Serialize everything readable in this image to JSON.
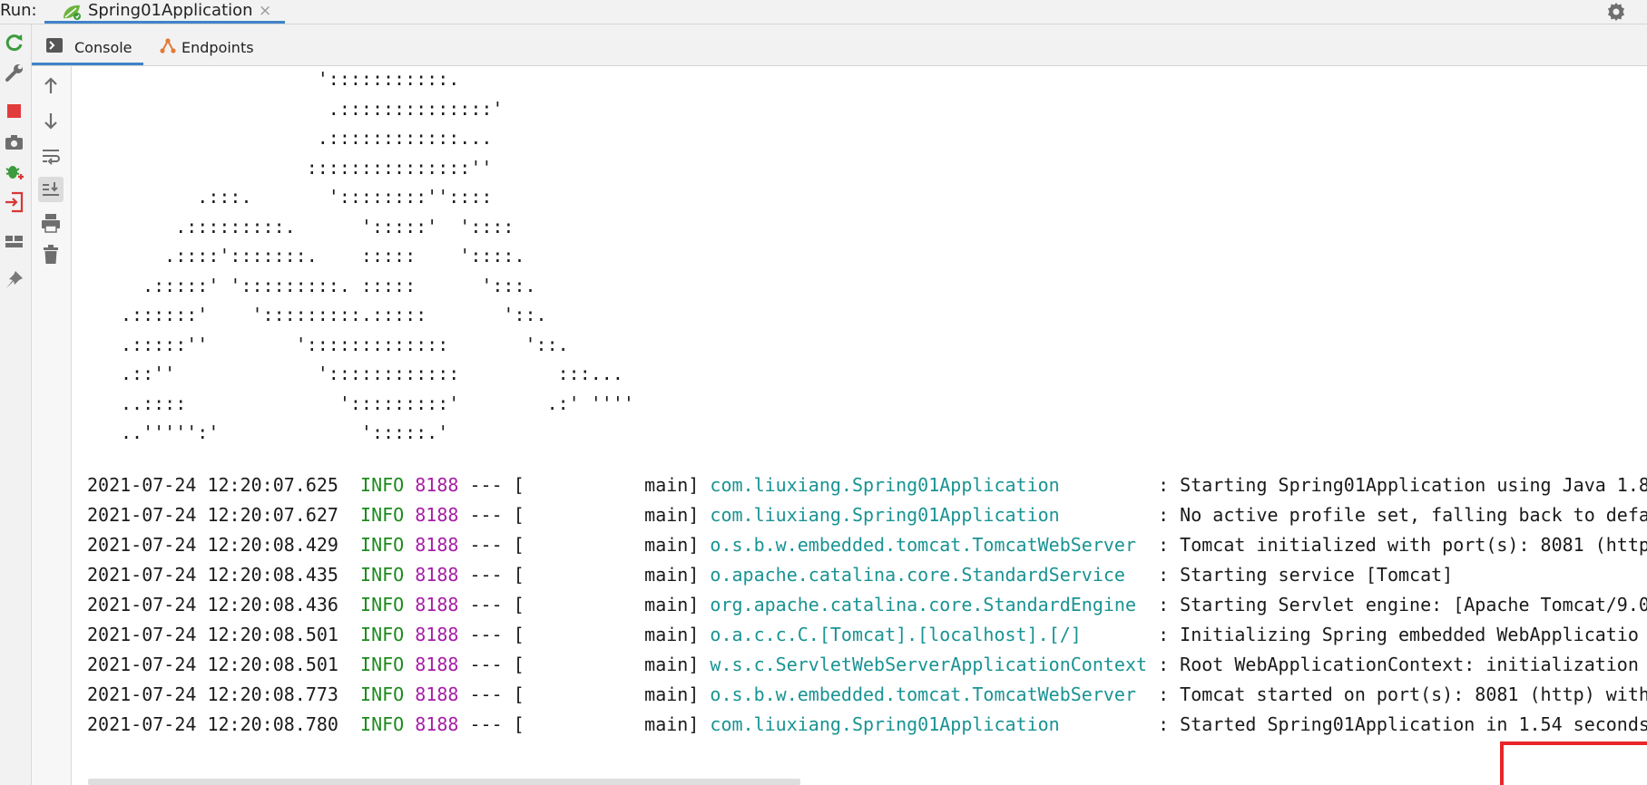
{
  "runbar": {
    "label": "Run:",
    "tab_title": "Spring01Application",
    "close": "×"
  },
  "subtabs": [
    {
      "label": "Console",
      "icon": "console-icon",
      "active": true
    },
    {
      "label": "Endpoints",
      "icon": "endpoints-icon",
      "active": false
    }
  ],
  "left_toolbar": [
    "rerun-icon",
    "wrench-icon",
    "stop-icon",
    "camera-icon",
    "debug-icon",
    "exit-icon",
    "layout-icon",
    "pin-icon"
  ],
  "console_toolbar": [
    "arrow-up-icon",
    "arrow-down-icon",
    "soft-wrap-icon",
    "scroll-to-end-icon",
    "print-icon",
    "trash-icon"
  ],
  "ascii_art": [
    "                  ':::::::::::.",
    "                   .::::::::::::::'",
    "                  .::::::::::::...",
    "                 :::::::::::::::''",
    "       .:::.       '::::::::''::::",
    "     .:::::::::.      ':::::'  '::::",
    "    .::::':::::::.    :::::    '::::.",
    "  .:::::' ':::::::::. :::::      ':::.",
    ".::::::'    ':::::::::.:::::       '::.",
    ".:::::''        ':::::::::::::       '::.",
    ".::''             '::::::::::::         :::...",
    "..::::              ':::::::::'        .:' ''''",
    "..''''':'             ':::::.'"
  ],
  "logs": [
    {
      "ts": "2021-07-24 12:20:07.625",
      "level": "INFO",
      "pid": "8188",
      "sep": "--- [",
      "thread": "           main]",
      "logger": "com.liuxiang.Spring01Application        ",
      "msg": " : Starting Spring01Application using Java 1.8"
    },
    {
      "ts": "2021-07-24 12:20:07.627",
      "level": "INFO",
      "pid": "8188",
      "sep": "--- [",
      "thread": "           main]",
      "logger": "com.liuxiang.Spring01Application        ",
      "msg": " : No active profile set, falling back to defa"
    },
    {
      "ts": "2021-07-24 12:20:08.429",
      "level": "INFO",
      "pid": "8188",
      "sep": "--- [",
      "thread": "           main]",
      "logger": "o.s.b.w.embedded.tomcat.TomcatWebServer ",
      "msg": " : Tomcat initialized with port(s): 8081 (http"
    },
    {
      "ts": "2021-07-24 12:20:08.435",
      "level": "INFO",
      "pid": "8188",
      "sep": "--- [",
      "thread": "           main]",
      "logger": "o.apache.catalina.core.StandardService  ",
      "msg": " : Starting service [Tomcat]"
    },
    {
      "ts": "2021-07-24 12:20:08.436",
      "level": "INFO",
      "pid": "8188",
      "sep": "--- [",
      "thread": "           main]",
      "logger": "org.apache.catalina.core.StandardEngine ",
      "msg": " : Starting Servlet engine: [Apache Tomcat/9.0"
    },
    {
      "ts": "2021-07-24 12:20:08.501",
      "level": "INFO",
      "pid": "8188",
      "sep": "--- [",
      "thread": "           main]",
      "logger": "o.a.c.c.C.[Tomcat].[localhost].[/]      ",
      "msg": " : Initializing Spring embedded WebApplicatio"
    },
    {
      "ts": "2021-07-24 12:20:08.501",
      "level": "INFO",
      "pid": "8188",
      "sep": "--- [",
      "thread": "           main]",
      "logger": "w.s.c.ServletWebServerApplicationContext",
      "msg": " : Root WebApplicationContext: initialization c"
    },
    {
      "ts": "2021-07-24 12:20:08.773",
      "level": "INFO",
      "pid": "8188",
      "sep": "--- [",
      "thread": "           main]",
      "logger": "o.s.b.w.embedded.tomcat.TomcatWebServer ",
      "msg": " : Tomcat started on port(s): 8081 (http) with"
    },
    {
      "ts": "2021-07-24 12:20:08.780",
      "level": "INFO",
      "pid": "8188",
      "sep": "--- [",
      "thread": "           main]",
      "logger": "com.liuxiang.Spring01Application        ",
      "msg": " : Started Spring01Application in 1.54 seconds"
    }
  ],
  "colors": {
    "info": "#1e8a1e",
    "pid": "#a61fa6",
    "logger": "#1a9393",
    "accent": "#4083c9",
    "highlight": "#e8262a"
  }
}
